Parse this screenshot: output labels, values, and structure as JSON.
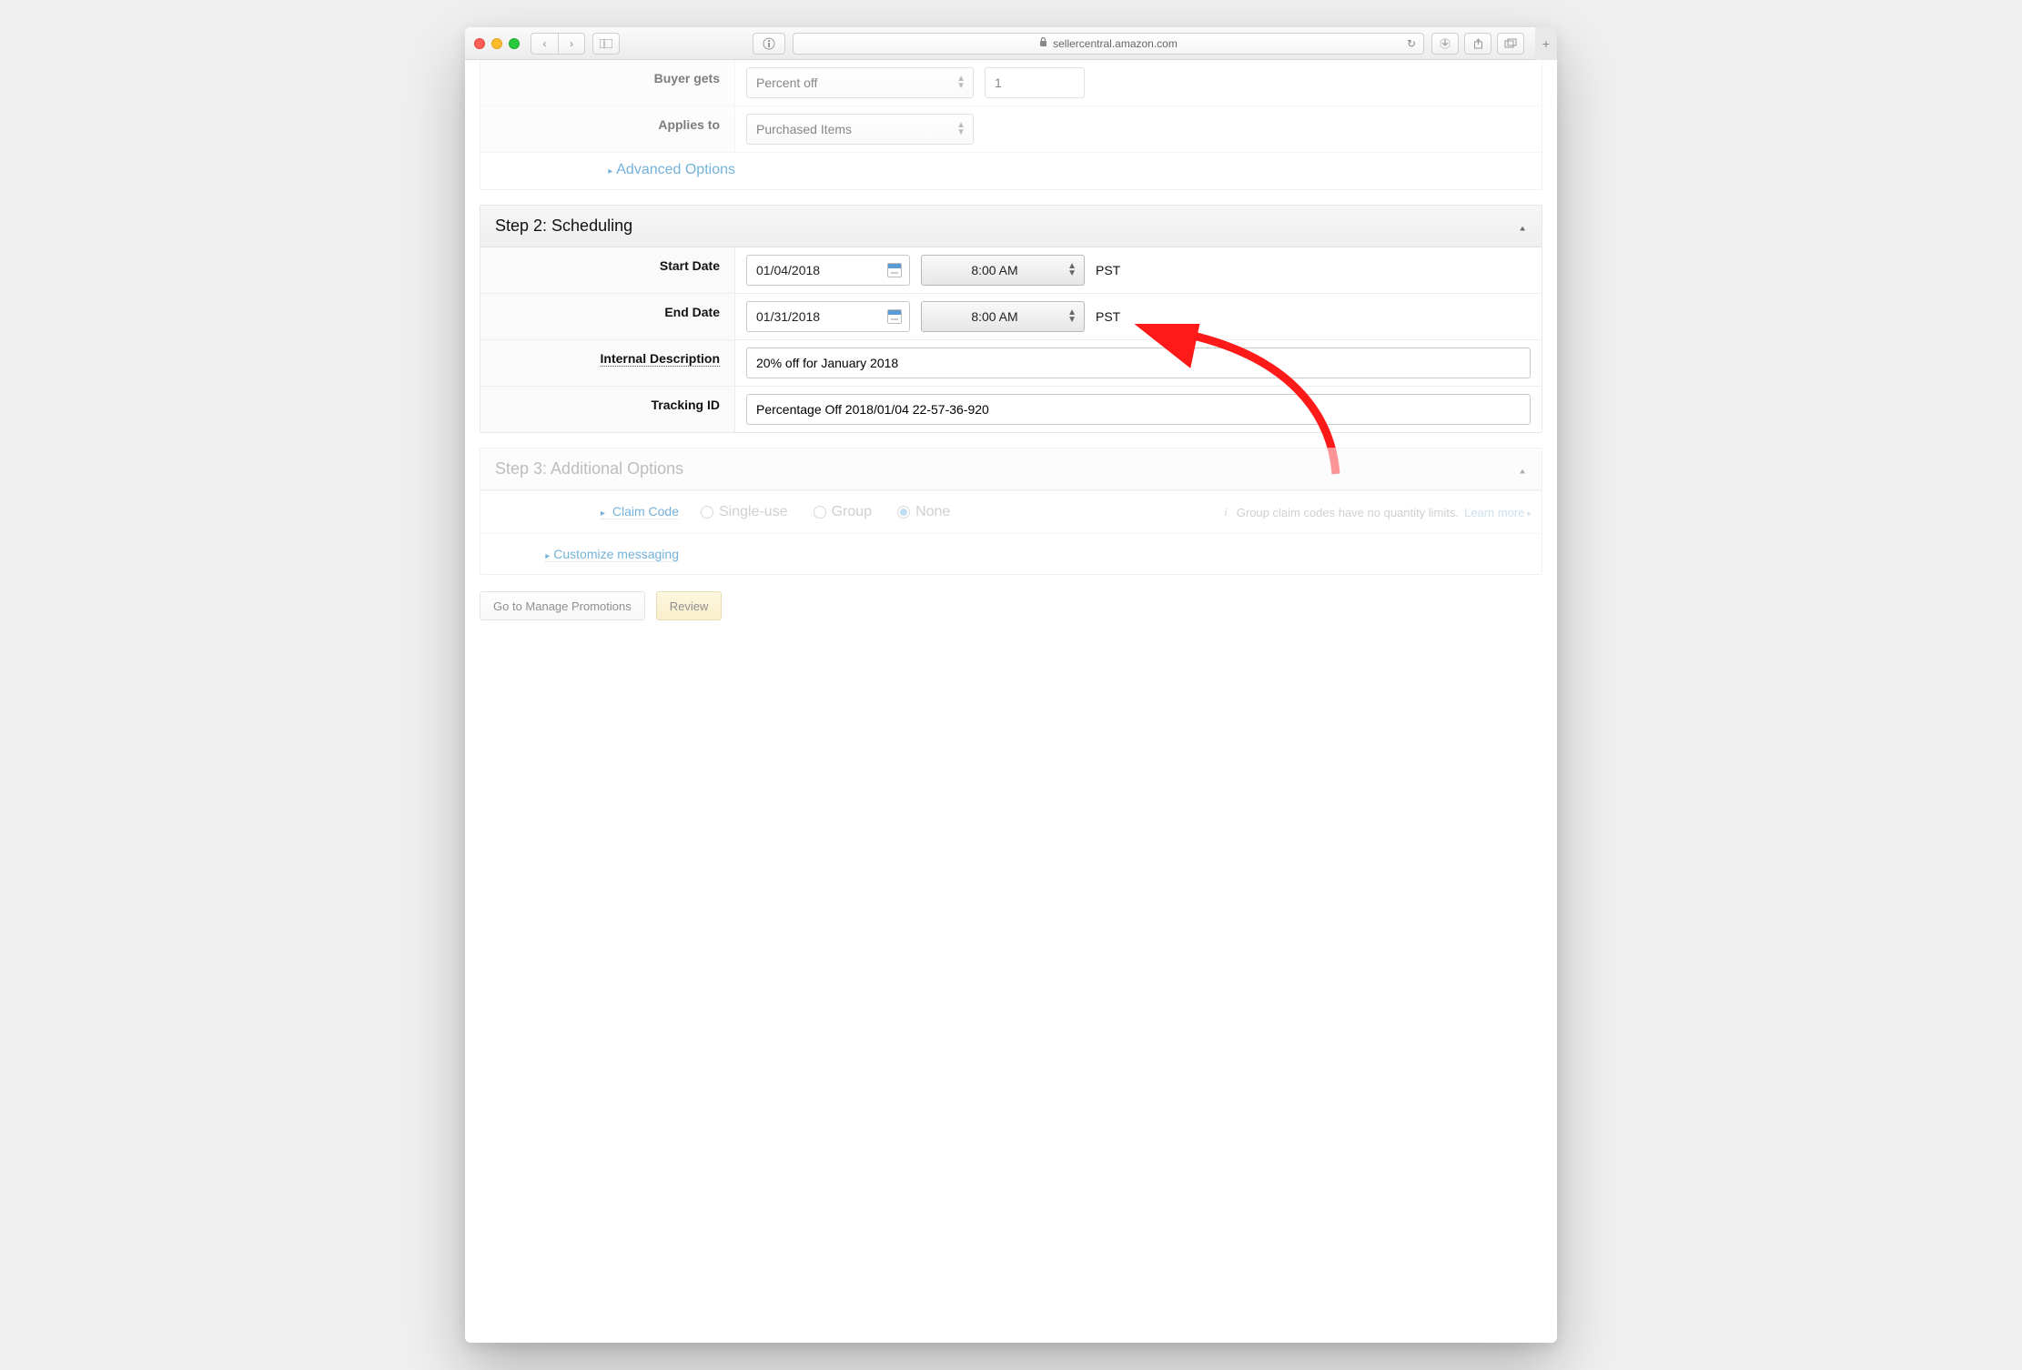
{
  "browser": {
    "url": "sellercentral.amazon.com"
  },
  "section1": {
    "buyer_gets_label": "Buyer gets",
    "buyer_gets_select": "Percent off",
    "buyer_gets_value": "1",
    "applies_to_label": "Applies to",
    "applies_to_select": "Purchased Items",
    "advanced_options": "Advanced Options"
  },
  "section2": {
    "title": "Step 2: Scheduling",
    "start_date_label": "Start Date",
    "start_date": "01/04/2018",
    "start_time": "8:00 AM",
    "start_tz": "PST",
    "end_date_label": "End Date",
    "end_date": "01/31/2018",
    "end_time": "8:00 AM",
    "end_tz": "PST",
    "internal_desc_label": "Internal Description",
    "internal_desc": "20% off for January 2018",
    "tracking_id_label": "Tracking ID",
    "tracking_id": "Percentage Off 2018/01/04 22-57-36-920"
  },
  "section3": {
    "title": "Step 3: Additional Options",
    "claim_code_label": "Claim Code",
    "single_use": "Single-use",
    "group": "Group",
    "none": "None",
    "info": "Group claim codes have no quantity limits.",
    "learn_more": "Learn more",
    "customize_msg": "Customize messaging"
  },
  "footer": {
    "manage": "Go to Manage Promotions",
    "review": "Review"
  }
}
